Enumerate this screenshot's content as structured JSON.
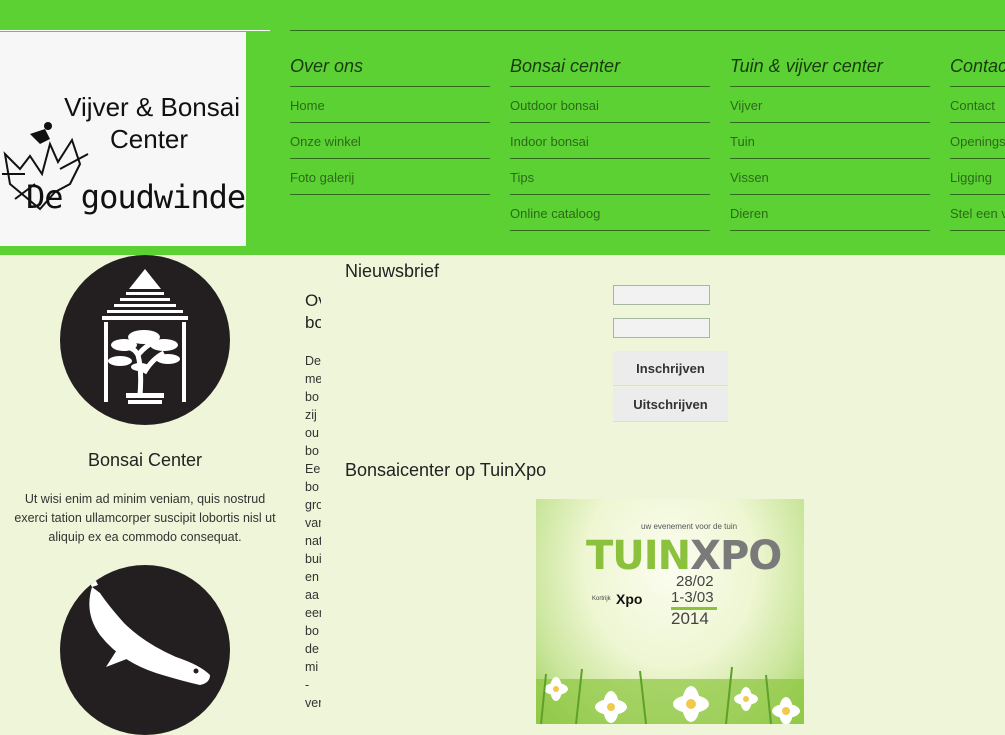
{
  "logo": {
    "line1": "Vijver & Bonsai",
    "line2": "Center",
    "line3": "De goudwinde"
  },
  "nav": {
    "columns": [
      {
        "heading": "Over ons",
        "items": [
          "Home",
          "Onze winkel",
          "Foto galerij"
        ]
      },
      {
        "heading": "Bonsai center",
        "items": [
          "Outdoor bonsai",
          "Indoor bonsai",
          "Tips",
          "Online cataloog"
        ]
      },
      {
        "heading": "Tuin & vijver center",
        "items": [
          "Vijver",
          "Tuin",
          "Vissen",
          "Dieren"
        ]
      },
      {
        "heading": "Contact",
        "items": [
          "Contact",
          "Openingsuren",
          "Ligging",
          "Stel een vraag"
        ]
      }
    ]
  },
  "features": {
    "bonsai": {
      "title": "Bonsai Center",
      "text": "Ut wisi enim ad minim veniam, quis nostrud exerci tation ullamcorper suscipit lobortis nisl ut aliquip ex ea commodo consequat."
    }
  },
  "middle": {
    "heading_1": "Over",
    "heading_2": "bonsai",
    "lines": [
      "De",
      "me",
      "bo",
      "zij",
      "ou",
      "bo",
      "Ee",
      "bo",
      "gro",
      "var",
      "nat",
      "bui",
      "en",
      "aa",
      "eer",
      "bo",
      "de",
      "mi",
      "-",
      "ver"
    ]
  },
  "newsletter": {
    "title": "Nieuwsbrief",
    "name_value": "",
    "email_value": "",
    "subscribe_label": "Inschrijven",
    "unsubscribe_label": "Uitschrijven"
  },
  "tuinxpo": {
    "title": "Bonsaicenter op TuinXpo",
    "poster": {
      "tagline": "uw evenement voor de tuin",
      "brand_tuin": "TUIN",
      "brand_xpo": "XPO",
      "date_1": "28/02",
      "date_2": "1-3/03",
      "year": "2014",
      "kortrijk": "Kortrijk",
      "kortrijk_xpo": "Xpo"
    }
  },
  "colors": {
    "header_green": "#5bd134",
    "page_background": "#eef5d9",
    "nav_text": "#2d6a18",
    "circle_dark": "#231f20"
  }
}
